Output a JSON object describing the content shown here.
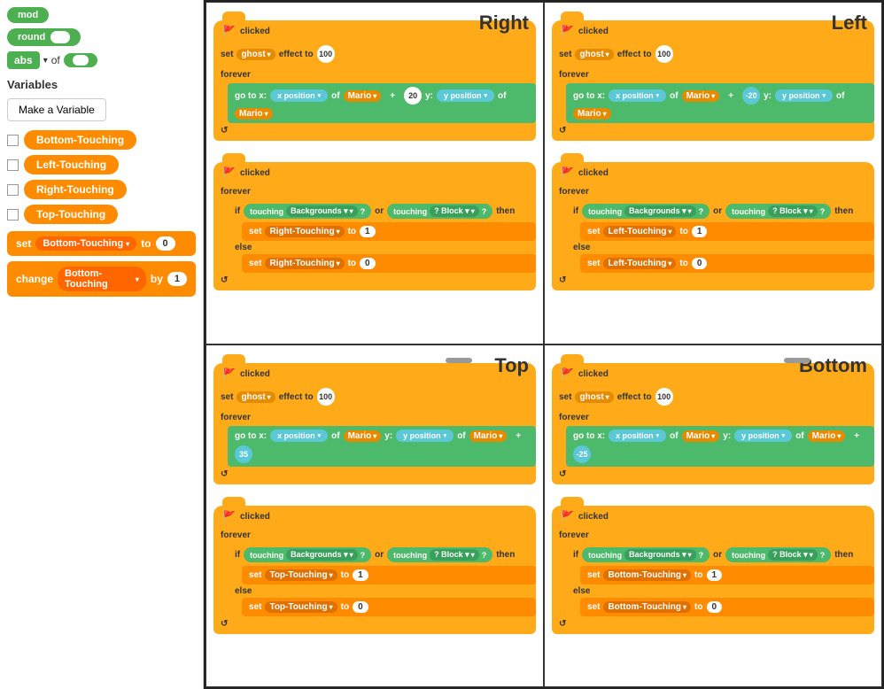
{
  "sidebar": {
    "items": [
      {
        "label": "mod"
      },
      {
        "label": "round"
      },
      {
        "label": "abs"
      },
      {
        "label": "of"
      }
    ],
    "variables_title": "Variables",
    "make_variable_btn": "Make a Variable",
    "variable_list": [
      {
        "label": "Bottom-Touching"
      },
      {
        "label": "Left-Touching"
      },
      {
        "label": "Right-Touching"
      },
      {
        "label": "Top-Touching"
      }
    ],
    "set_block": {
      "text": "set",
      "variable": "Bottom-Touching",
      "to": "0"
    },
    "change_block": {
      "text": "change",
      "variable": "Bottom-Touching",
      "by": "1"
    }
  },
  "quadrants": {
    "top_right": {
      "label": "Right",
      "scripts": [
        {
          "type": "when_clicked_set_ghost_forever_goto",
          "goto_offset": "+20",
          "goto_axis": "x"
        },
        {
          "type": "when_clicked_forever_if_touching",
          "variable": "Right-Touching",
          "true_val": "1",
          "false_val": "0"
        }
      ]
    },
    "top_left_screen": {
      "label": "Left",
      "scripts": [
        {
          "type": "when_clicked_set_ghost_forever_goto",
          "goto_offset": "-20",
          "goto_axis": "x"
        },
        {
          "type": "when_clicked_forever_if_touching",
          "variable": "Left-Touching",
          "true_val": "1",
          "false_val": "0"
        }
      ]
    },
    "bottom_left": {
      "label": "Top",
      "scripts": [
        {
          "type": "when_clicked_set_ghost_forever_goto",
          "goto_offset": "+35",
          "goto_axis": "y"
        },
        {
          "type": "when_clicked_forever_if_touching",
          "variable": "Top-Touching",
          "true_val": "1",
          "false_val": "0"
        }
      ]
    },
    "bottom_right": {
      "label": "Bottom",
      "scripts": [
        {
          "type": "when_clicked_set_ghost_forever_goto",
          "goto_offset": "-25",
          "goto_axis": "y"
        },
        {
          "type": "when_clicked_forever_if_touching",
          "variable": "Bottom-Touching",
          "true_val": "1",
          "false_val": "0"
        }
      ]
    }
  },
  "colors": {
    "orange": "#ffab19",
    "orange_dark": "#ff8c00",
    "green": "#4db96a",
    "teal": "#5bc8d8",
    "purple": "#9966ff",
    "blue_inp": "#5cb5ff"
  }
}
